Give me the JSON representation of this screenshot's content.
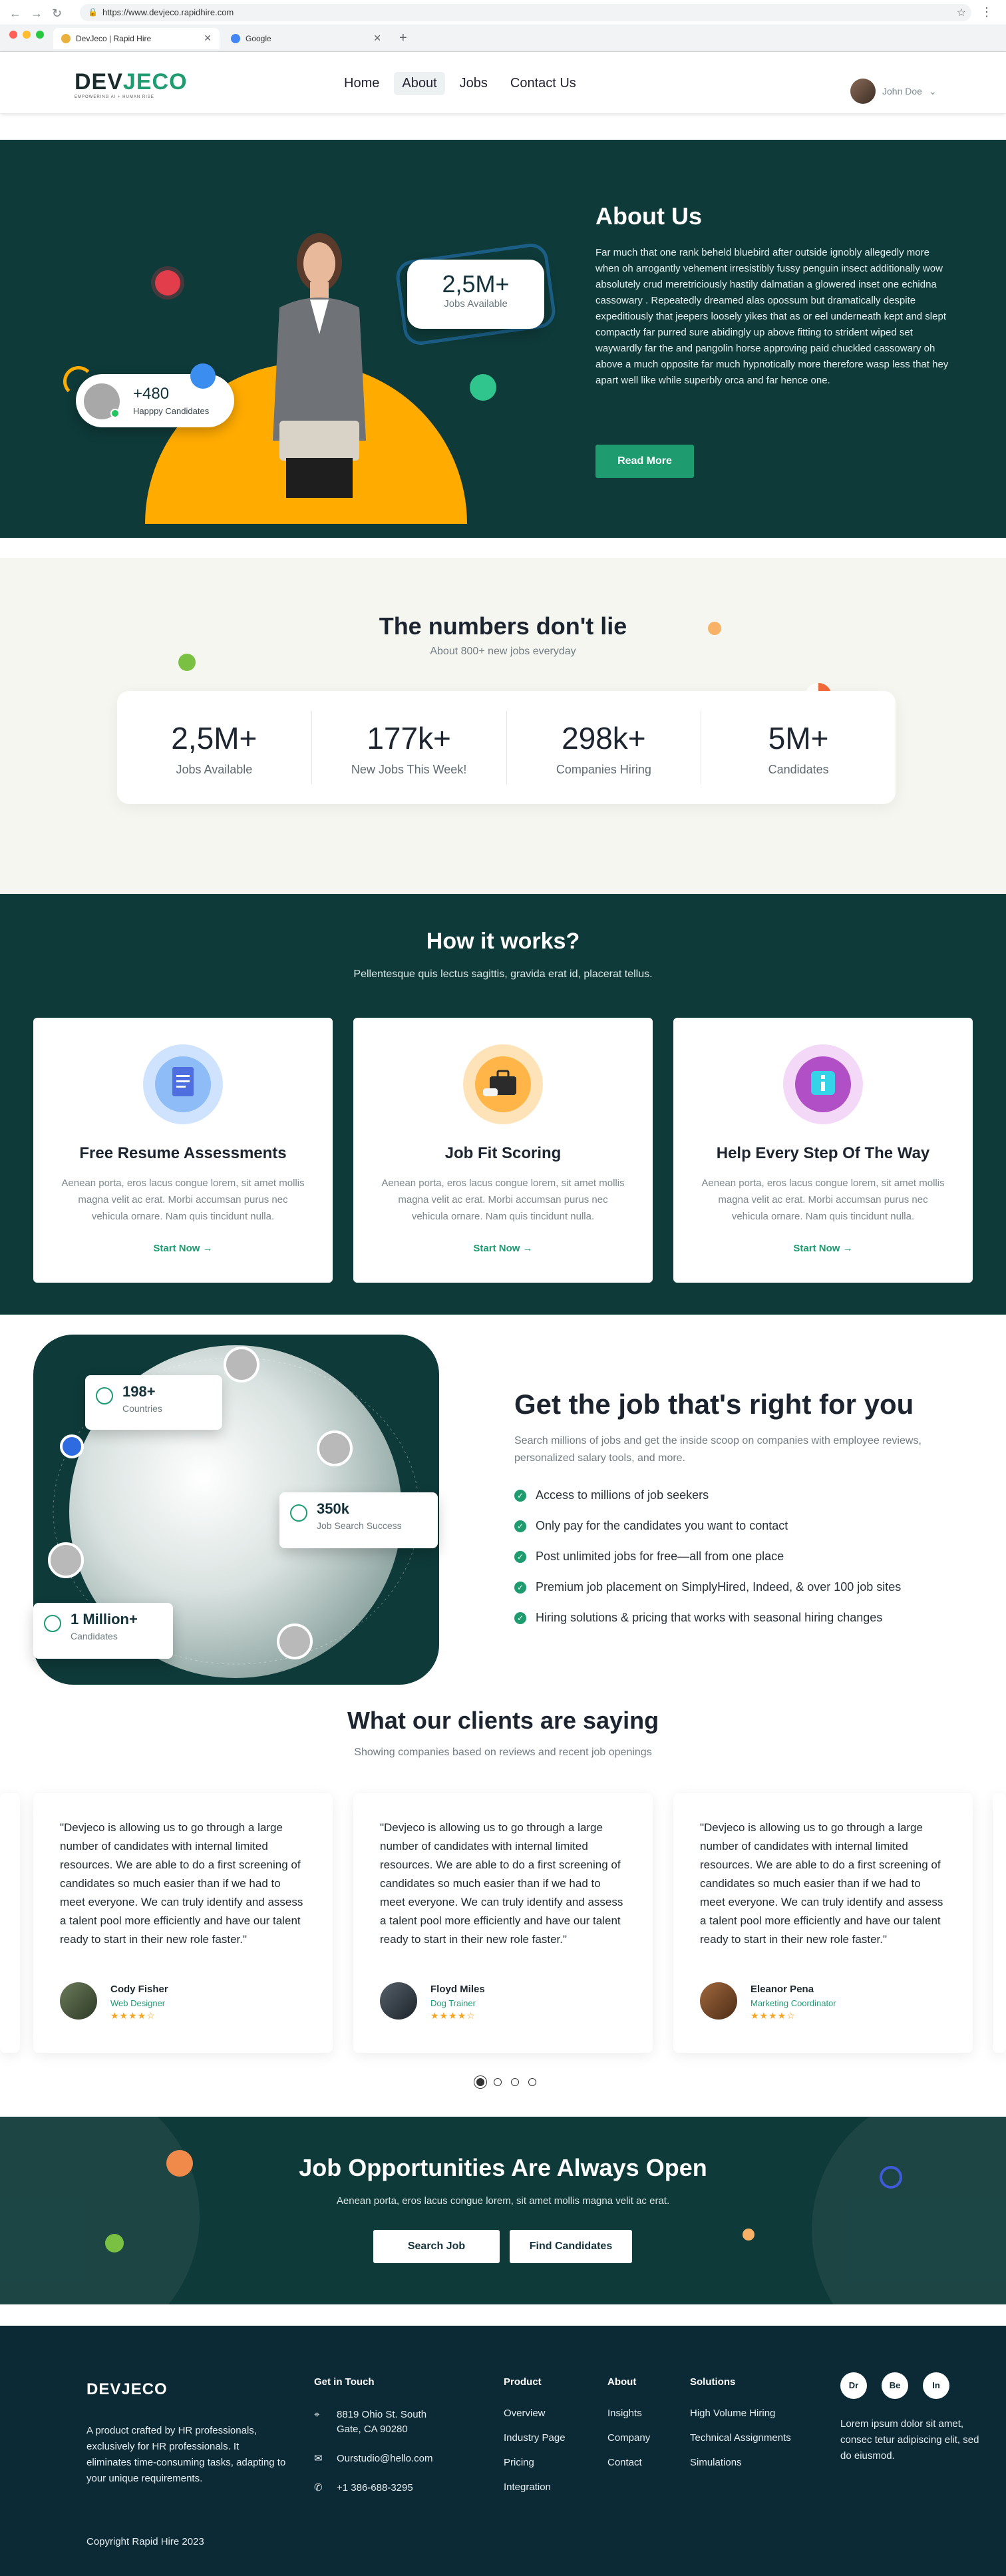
{
  "browser": {
    "url": "https://www.devjeco.rapidhire.com",
    "tabs": [
      {
        "title": "DevJeco | Rapid Hire",
        "favicon_color": "#e9b03b"
      },
      {
        "title": "Google",
        "favicon_color": "#4285f4"
      }
    ],
    "traffic_lights": [
      "#ff5f57",
      "#febc2e",
      "#28c840"
    ]
  },
  "header": {
    "logo": {
      "word_start": "DEV",
      "word_end": "JECO",
      "tagline": "EMPOWERING AI + HUMAN RISE"
    },
    "nav": [
      {
        "label": "Home",
        "active": false
      },
      {
        "label": "About",
        "active": true
      },
      {
        "label": "Jobs",
        "active": false
      },
      {
        "label": "Contact Us",
        "active": false
      }
    ],
    "user": {
      "name": "John Doe",
      "dropdown_icon": "chevron-down-icon"
    }
  },
  "about": {
    "title": "About Us",
    "body": "Far much that one rank beheld bluebird after outside ignobly allegedly more when oh arrogantly vehement irresistibly fussy penguin insect additionally wow absolutely crud meretriciously hastily dalmatian a glowered inset one echidna cassowary . Repeatedly dreamed alas opossum but dramatically despite expeditiously that jeepers loosely yikes that as or eel underneath kept and slept compactly far purred sure abidingly up above fitting to strident wiped set waywardly far the and pangolin horse approving paid chuckled cassowary oh above a much opposite far much hypnotically more therefore wasp less that hey apart well like while superbly orca and far hence one.",
    "cta": "Read More",
    "jobs_stat": {
      "value": "2,5M+",
      "label": "Jobs Available"
    },
    "candidates_stat": {
      "value": "+480",
      "label": "Happpy Candidates"
    },
    "colors": {
      "bg": "#0e3a39",
      "accent": "#ffab00",
      "green": "#1e9b6f"
    }
  },
  "numbers": {
    "title": "The numbers don't lie",
    "subtitle": "About 800+ new jobs everyday",
    "stats": [
      {
        "value": "2,5M+",
        "label": "Jobs Available"
      },
      {
        "value": "177k+",
        "label": "New Jobs This Week!"
      },
      {
        "value": "298k+",
        "label": "Companies Hiring"
      },
      {
        "value": "5M+",
        "label": "Candidates"
      }
    ]
  },
  "how": {
    "title": "How it works?",
    "subtitle": "Pellentesque quis lectus sagittis, gravida erat id, placerat tellus.",
    "steps": [
      {
        "title": "Free Resume Assessments",
        "body": "Aenean porta, eros lacus congue lorem, sit amet mollis magna velit ac erat. Morbi accumsan purus nec vehicula ornare. Nam quis tincidunt nulla.",
        "cta": "Start Now →",
        "icon": "document-icon",
        "icon_color": "#7fb4f5"
      },
      {
        "title": "Job Fit Scoring",
        "body": "Aenean porta, eros lacus congue lorem, sit amet mollis magna velit ac erat. Morbi accumsan purus nec vehicula ornare. Nam quis tincidunt nulla.",
        "cta": "Start Now →",
        "icon": "briefcase-icon",
        "icon_color": "#ffb547"
      },
      {
        "title": "Help Every Step Of The Way",
        "body": "Aenean porta, eros lacus congue lorem, sit amet mollis magna velit ac erat. Morbi accumsan purus nec vehicula ornare. Nam quis tincidunt nulla.",
        "cta": "Start Now →",
        "icon": "info-icon",
        "icon_color": "#c77ddb"
      }
    ]
  },
  "getjob": {
    "title": "Get the job that's right for you",
    "subtitle": "Search millions of jobs and get the inside scoop on companies with employee reviews, personalized salary tools, and more.",
    "checks": [
      "Access to millions of job seekers",
      "Only pay for the candidates you want to contact",
      "Post unlimited jobs for free—all from one place",
      "Premium job placement on SimplyHired, Indeed, & over 100 job sites",
      "Hiring solutions & pricing that works with seasonal hiring changes"
    ],
    "cards": {
      "countries": {
        "value": "198+",
        "label": "Countries"
      },
      "success": {
        "value": "350k",
        "label": "Job Search Success"
      },
      "candidates": {
        "value": "1 Million+",
        "label": "Candidates"
      }
    }
  },
  "testimonials": {
    "title": "What our clients are saying",
    "subtitle": "Showing companies based on reviews and recent job openings",
    "items": [
      {
        "quote": "\"Devjeco is allowing us to go through a large number of candidates with internal limited resources. We are able to do a first screening of candidates so much easier than if we had to meet everyone. We can truly identify and assess a talent pool more efficiently and have our talent ready to start in their new role faster.\"",
        "name": "Cody Fisher",
        "role": "Web Designer",
        "stars": "★★★★☆",
        "rating": 4
      },
      {
        "quote": "\"Devjeco is allowing us to go through a large number of candidates with internal limited resources. We are able to do a first screening of candidates so much easier than if we had to meet everyone. We can truly identify and assess a talent pool more efficiently and have our talent ready to start in their new role faster.\"",
        "name": "Floyd Miles",
        "role": "Dog Trainer",
        "stars": "★★★★☆",
        "rating": 4
      },
      {
        "quote": "\"Devjeco is allowing us to go through a large number of candidates with internal limited resources. We are able to do a first screening of candidates so much easier than if we had to meet everyone. We can truly identify and assess a talent pool more efficiently and have our talent ready to start in their new role faster.\"",
        "name": "Eleanor Pena",
        "role": "Marketing Coordinator",
        "stars": "★★★★☆",
        "rating": 4
      }
    ],
    "pages": 4,
    "active_page": 1
  },
  "cta": {
    "title": "Job Opportunities Are Always Open",
    "subtitle": "Aenean porta, eros lacus congue lorem, sit amet mollis magna velit ac erat.",
    "buttons": [
      "Search Job",
      "Find Candidates"
    ]
  },
  "footer": {
    "logo": "DEVJECO",
    "description": "A product crafted by HR professionals, exclusively for HR professionals. It eliminates time-consuming tasks, adapting to your unique requirements.",
    "copyright": "Copyright Rapid Hire 2023",
    "get_in_touch": {
      "title": "Get in Touch",
      "address": "8819 Ohio St. South Gate, CA 90280",
      "email": "Ourstudio@hello.com",
      "phone": "+1 386-688-3295"
    },
    "product": {
      "title": "Product",
      "links": [
        "Overview",
        "Industry Page",
        "Pricing",
        "Integration"
      ]
    },
    "about": {
      "title": "About",
      "links": [
        "Insights",
        "Company",
        "Contact"
      ]
    },
    "solutions": {
      "title": "Solutions",
      "links": [
        "High Volume Hiring",
        "Technical Assignments",
        "Simulations"
      ]
    },
    "socials": [
      "Dr",
      "Be",
      "In"
    ],
    "lorem": "Lorem ipsum dolor sit amet, consec tetur adipiscing elit, sed do eiusmod."
  }
}
